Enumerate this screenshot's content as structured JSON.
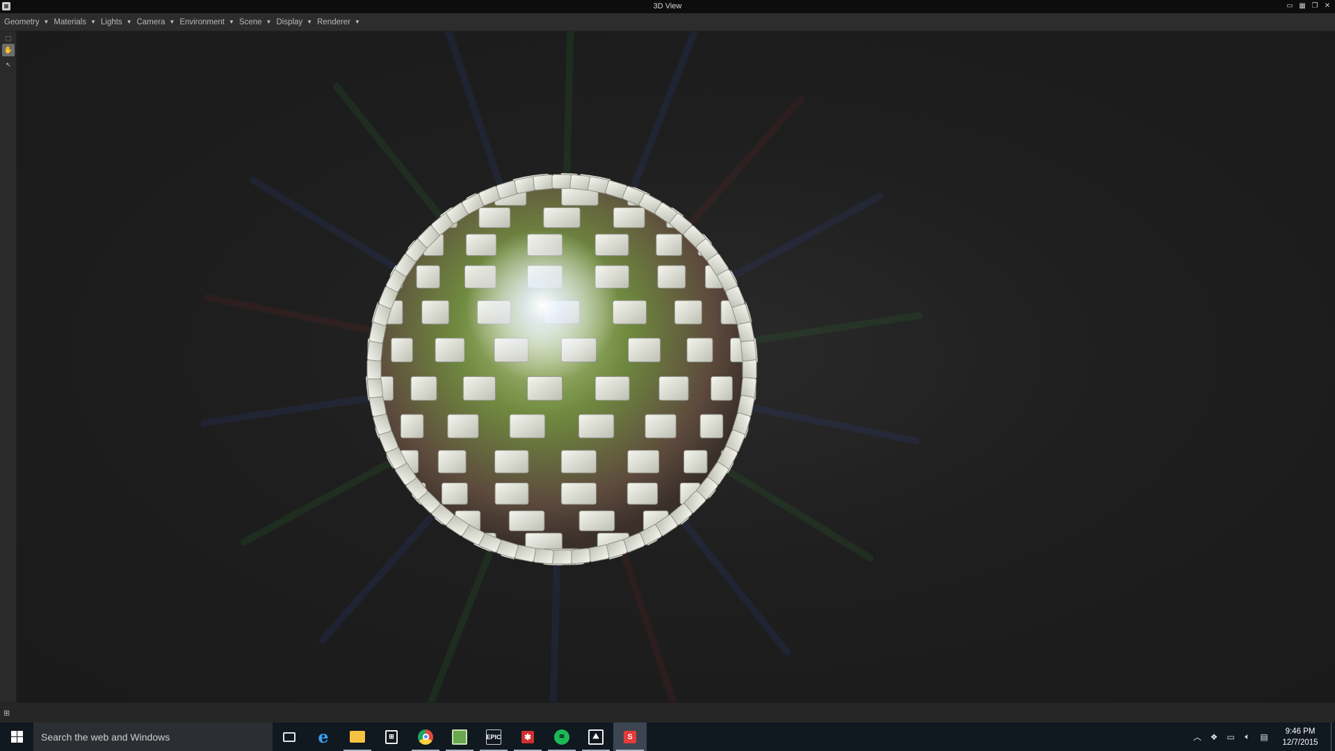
{
  "window": {
    "title": "3D View",
    "controls": [
      "pin-icon",
      "layout-icon",
      "restore-icon",
      "close-icon"
    ]
  },
  "menu": {
    "items": [
      {
        "label": "Geometry"
      },
      {
        "label": "Materials"
      },
      {
        "label": "Lights"
      },
      {
        "label": "Camera"
      },
      {
        "label": "Environment"
      },
      {
        "label": "Scene"
      },
      {
        "label": "Display"
      },
      {
        "label": "Renderer"
      }
    ]
  },
  "toolbar": {
    "tools": [
      "popout-icon",
      "hand-tool-icon",
      "pick-tool-icon"
    ],
    "active_tool": "hand-tool-icon"
  },
  "viewport": {
    "object": "sphere-of-cubes",
    "background_color": "#1c1c1c",
    "cube_color": "#dfe0d6"
  },
  "statusbar": {
    "icon": "tree-view-icon"
  },
  "taskbar": {
    "search_placeholder": "Search the web and Windows",
    "apps": [
      {
        "name": "task-view-icon"
      },
      {
        "name": "edge-icon"
      },
      {
        "name": "file-explorer-icon"
      },
      {
        "name": "store-icon"
      },
      {
        "name": "chrome-icon"
      },
      {
        "name": "app-icon"
      },
      {
        "name": "epic-games-icon",
        "text": "EPIC"
      },
      {
        "name": "red-app-icon"
      },
      {
        "name": "spotify-icon"
      },
      {
        "name": "photos-icon"
      },
      {
        "name": "keyshot-icon"
      }
    ],
    "time": "9:46 PM",
    "date": "12/7/2015"
  }
}
